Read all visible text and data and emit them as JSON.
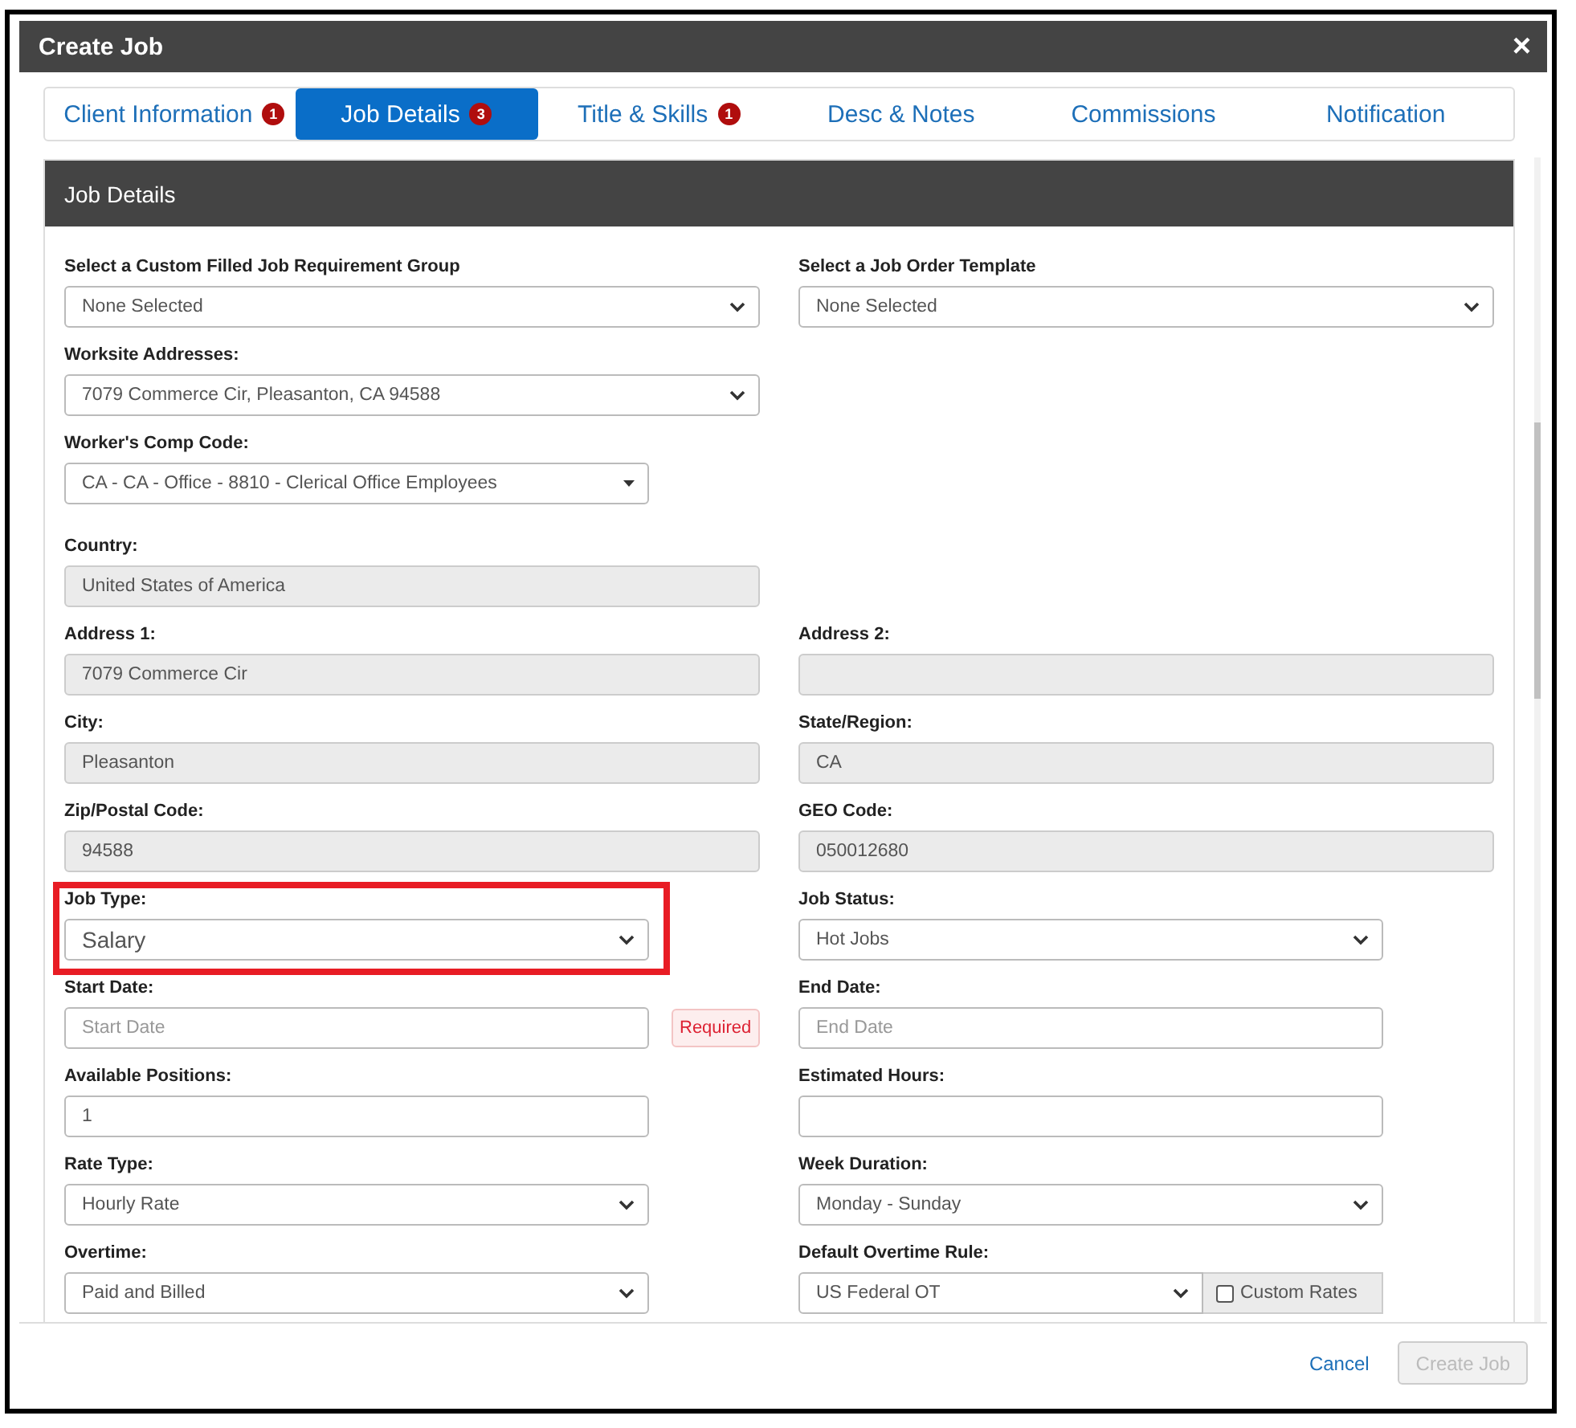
{
  "window": {
    "title": "Create Job",
    "close": "×"
  },
  "tabs": [
    {
      "label": "Client Information",
      "badge": "1",
      "selected": false
    },
    {
      "label": "Job Details",
      "badge": "3",
      "selected": true
    },
    {
      "label": "Title & Skills",
      "badge": "1",
      "selected": false
    },
    {
      "label": "Desc & Notes",
      "selected": false
    },
    {
      "label": "Commissions",
      "selected": false
    },
    {
      "label": "Notification",
      "selected": false
    }
  ],
  "panel": {
    "title": "Job Details"
  },
  "rows": [
    {
      "left": {
        "label": "Select a Custom Filled Job Requirement Group",
        "kind": "select",
        "value": "None Selected"
      },
      "right": {
        "label": "Select a Job Order Template",
        "kind": "select",
        "value": "None Selected"
      }
    },
    {
      "left": {
        "label": "Worksite Addresses:",
        "kind": "select",
        "value": "7079 Commerce Cir, Pleasanton, CA 94588"
      }
    },
    {
      "left": {
        "label": "Worker's Comp Code:",
        "kind": "dropdown",
        "value": "CA - CA - Office - 8810 - Clerical Office Employees"
      }
    },
    {
      "left": {
        "label": "Country:",
        "kind": "readonly",
        "value": "United States of America"
      }
    },
    {
      "left": {
        "label": "Address 1:",
        "kind": "readonly",
        "value": "7079 Commerce Cir"
      },
      "right": {
        "label": "Address 2:",
        "kind": "readonly"
      }
    },
    {
      "left": {
        "label": "City:",
        "kind": "readonly",
        "value": "Pleasanton"
      },
      "right": {
        "label": "State/Region:",
        "kind": "readonly",
        "value": "CA"
      }
    },
    {
      "left": {
        "label": "Zip/Postal Code:",
        "kind": "readonly",
        "value": "94588"
      },
      "right": {
        "label": "GEO Code:",
        "kind": "readonly",
        "value": "050012680"
      }
    },
    {
      "left": {
        "label": "Job Type:",
        "kind": "select",
        "value": "Salary",
        "highlighted": true
      },
      "right": {
        "label": "Job Status:",
        "kind": "select",
        "value": "Hot Jobs"
      }
    },
    {
      "left": {
        "label": "Start Date:",
        "kind": "input",
        "placeholder": "Start Date",
        "note": "Required"
      },
      "right": {
        "label": "End Date:",
        "kind": "input",
        "placeholder": "End Date"
      }
    },
    {
      "left": {
        "label": "Available Positions:",
        "kind": "input",
        "value": "1"
      },
      "right": {
        "label": "Estimated Hours:",
        "kind": "input"
      }
    },
    {
      "left": {
        "label": "Rate Type:",
        "kind": "select",
        "value": "Hourly Rate"
      },
      "right": {
        "label": "Week Duration:",
        "kind": "select",
        "value": "Monday - Sunday"
      }
    },
    {
      "left": {
        "label": "Overtime:",
        "kind": "select",
        "value": "Paid and Billed"
      },
      "right": {
        "label": "Default Overtime Rule:",
        "kind": "select",
        "value": "US Federal OT",
        "addon": {
          "label": "Custom Rates",
          "checked": false
        }
      }
    }
  ],
  "footer": {
    "cancel": "Cancel",
    "submit": {
      "label": "Create Job",
      "disabled": true
    }
  }
}
